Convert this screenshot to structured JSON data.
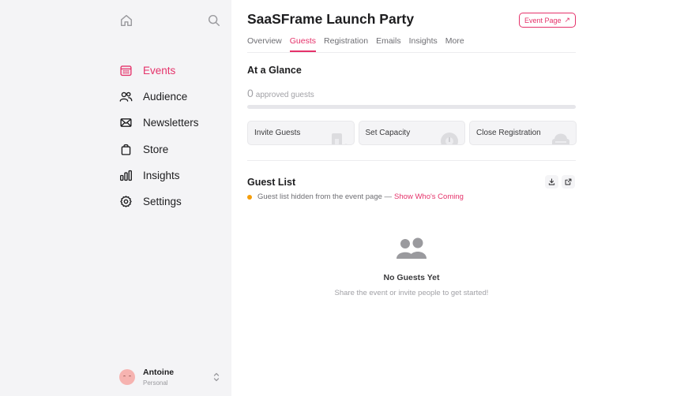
{
  "sidebar": {
    "home_icon": "home-icon",
    "search_icon": "search-icon",
    "items": [
      {
        "label": "Events",
        "icon": "calendar-icon",
        "active": true
      },
      {
        "label": "Audience",
        "icon": "people-icon"
      },
      {
        "label": "Newsletters",
        "icon": "mail-icon"
      },
      {
        "label": "Store",
        "icon": "bag-icon"
      },
      {
        "label": "Insights",
        "icon": "bar-chart-icon"
      },
      {
        "label": "Settings",
        "icon": "gear-icon"
      }
    ],
    "user": {
      "name": "Antoine",
      "subtitle": "Personal"
    }
  },
  "header": {
    "title": "SaaSFrame Launch Party",
    "event_page_label": "Event Page"
  },
  "tabs": [
    {
      "label": "Overview"
    },
    {
      "label": "Guests",
      "active": true
    },
    {
      "label": "Registration"
    },
    {
      "label": "Emails"
    },
    {
      "label": "Insights"
    },
    {
      "label": "More"
    }
  ],
  "glance": {
    "title": "At a Glance",
    "approved_count": "0",
    "approved_label": "approved guests",
    "progress_fraction": 0
  },
  "actions": [
    {
      "label": "Invite Guests",
      "icon": "invite-icon"
    },
    {
      "label": "Set Capacity",
      "icon": "capacity-icon"
    },
    {
      "label": "Close Registration",
      "icon": "close-registration-icon"
    }
  ],
  "guest_list": {
    "title": "Guest List",
    "notice": "Guest list hidden from the event page —",
    "notice_link": "Show Who's Coming",
    "empty_title": "No Guests Yet",
    "empty_subtitle": "Share the event or invite people to get started!"
  },
  "colors": {
    "accent": "#e5326a",
    "warning_dot": "#f59e0b",
    "sidebar_bg": "#f4f4f6"
  }
}
